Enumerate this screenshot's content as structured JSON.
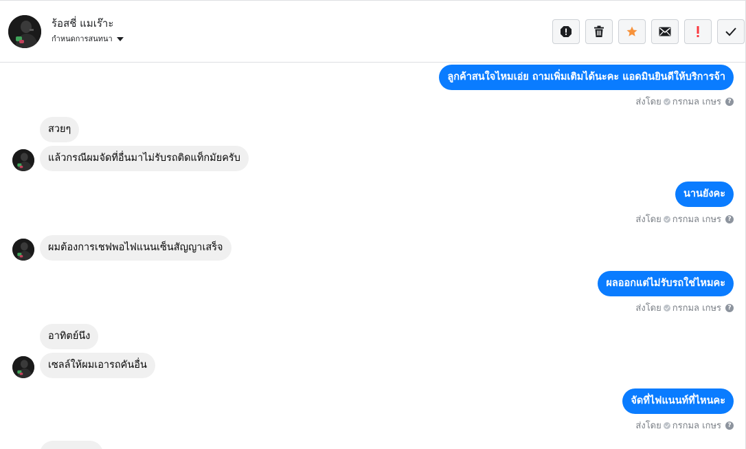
{
  "header": {
    "contact_name": "ร้อสชี่ แมเร๊าะ",
    "assign_label": "กำหนดการสนทนา",
    "actions": [
      {
        "name": "report-spam-icon",
        "color": "#1c1e21"
      },
      {
        "name": "trash-icon",
        "color": "#1c1e21"
      },
      {
        "name": "star-icon",
        "color": "#f7923b"
      },
      {
        "name": "mail-icon",
        "color": "#1c1e21"
      },
      {
        "name": "important-icon",
        "color": "#fa383e"
      },
      {
        "name": "checkmark-icon",
        "color": "#1c1e21"
      }
    ]
  },
  "colors": {
    "outgoing_bubble": "#0a7cff",
    "incoming_bubble": "#f0f0f0",
    "meta_text": "#7a7f86"
  },
  "messages": {
    "m1": {
      "text": "ลูกค้าสนใจไหมเอ่ย ถามเพิ่มเติมได้นะคะ แอดมินยินดีให้บริการจ้า",
      "sent_by_label": "ส่งโดย",
      "sender": "กรกมล เกษร"
    },
    "m2": {
      "text": "สวยๆ"
    },
    "m3": {
      "text": "แล้วกรณีผมจัดที่อื่นมาไม่รับรถติดแท็กมัยครับ"
    },
    "m4": {
      "text": "นานยังคะ",
      "sent_by_label": "ส่งโดย",
      "sender": "กรกมล เกษร"
    },
    "m5": {
      "text": "ผมต้องการเชฟพอไฟแนนเซ็นสัญญาเสร็จ"
    },
    "m6": {
      "text": "ผลออกแต่ไม่รับรถใช่ไหมคะ",
      "sent_by_label": "ส่งโดย",
      "sender": "กรกมล เกษร"
    },
    "m7": {
      "text": "อาทิตย์นึง"
    },
    "m8": {
      "text": "เซลล์ให้ผมเอารถคันอื่น"
    },
    "m9": {
      "text": "จัดที่ไฟแนนท์ที่ไหนคะ",
      "sent_by_label": "ส่งโดย",
      "sender": "กรกมล เกษร"
    }
  }
}
